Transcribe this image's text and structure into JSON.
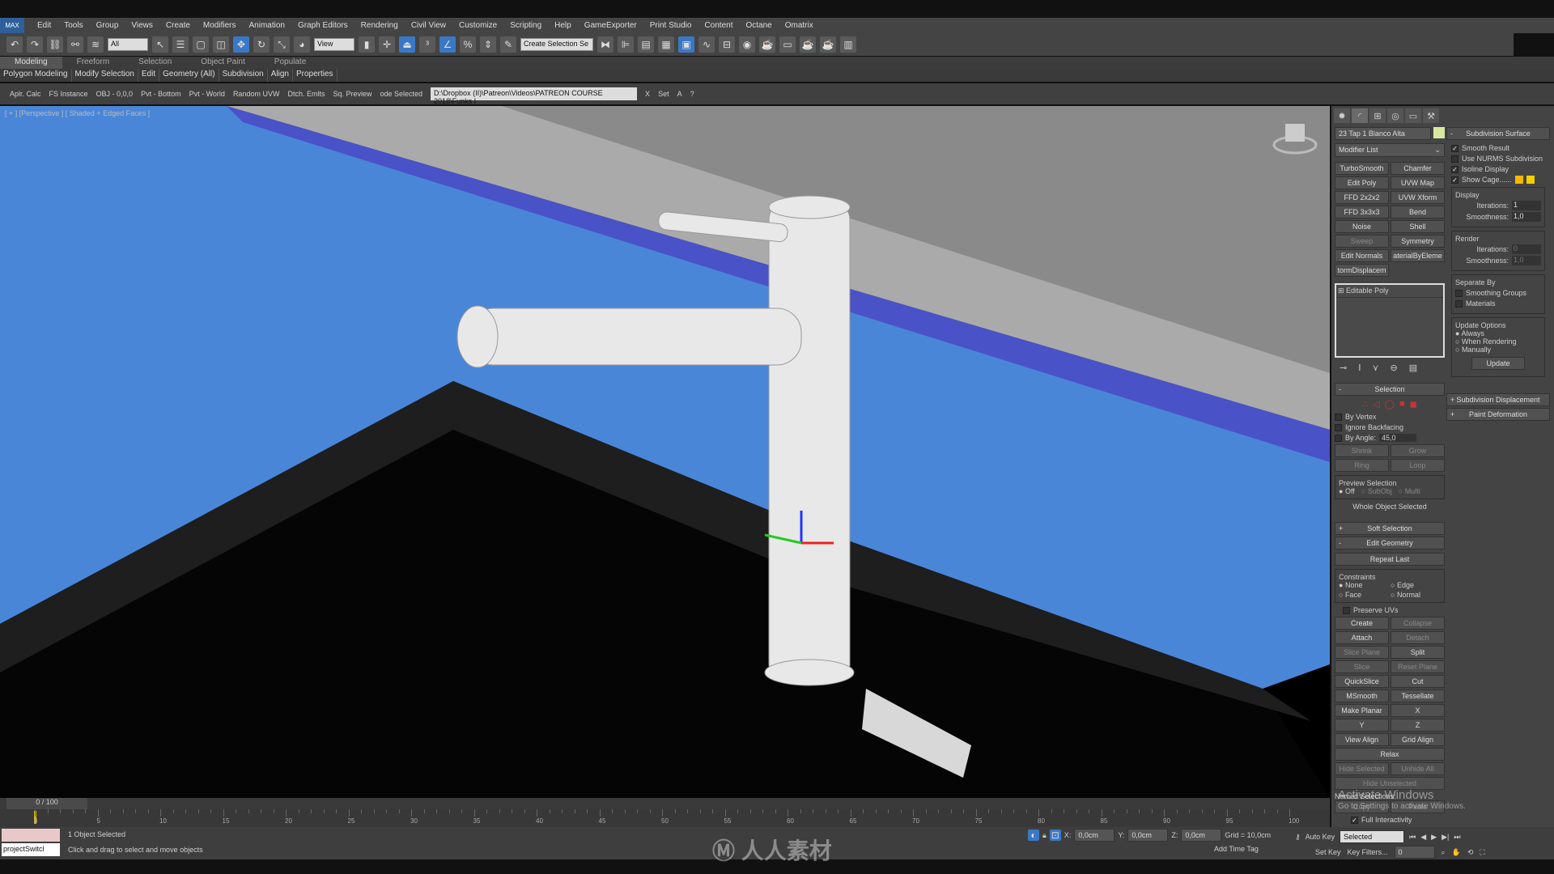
{
  "app": {
    "logo": "MAX"
  },
  "menu": [
    "Edit",
    "Tools",
    "Group",
    "Views",
    "Create",
    "Modifiers",
    "Animation",
    "Graph Editors",
    "Rendering",
    "Civil View",
    "Customize",
    "Scripting",
    "Help",
    "GameExporter",
    "Print Studio",
    "Content",
    "Octane",
    "Omatrix"
  ],
  "toolbar": {
    "filter": "All",
    "ref_coord": "View",
    "named_selection": "Create Selection Se"
  },
  "ribbon": {
    "tabs": [
      "Modeling",
      "Freeform",
      "Selection",
      "Object Paint",
      "Populate"
    ],
    "active": "Modeling",
    "groups": [
      "Polygon Modeling",
      "Modify Selection",
      "Edit",
      "Geometry (All)",
      "Subdivision",
      "Align",
      "Properties"
    ]
  },
  "extra_toolbar": {
    "items": [
      "Aplr. Calc",
      "FS Instance",
      "OBJ - 0,0,0",
      "Pvt - Bottom",
      "Pvt - World",
      "Random UVW",
      "Dtch. Emlts",
      "Sq. Preview",
      "ode Selected"
    ],
    "path": "D:\\Dropbox (II)\\Patreon\\Videos\\PATREON COURSE 2018\\Funks I",
    "x": "X",
    "set": "Set",
    "a": "A",
    "q": "?"
  },
  "viewport": {
    "label": "[ + ] [Perspective ] [ Shaded + Edged Faces ]"
  },
  "command_panel": {
    "object_name": "23 Tap 1 Blanco Alta",
    "object_color": "#d8e8a0",
    "modifier_list": "Modifier List",
    "modifier_buttons": [
      "TurboSmooth",
      "Chamfer",
      "Edit Poly",
      "UVW Map",
      "FFD 2x2x2",
      "UVW Xform",
      "FFD 3x3x3",
      "Bend",
      "Noise",
      "Shell",
      "Sweep",
      "Symmetry",
      "Edit Normals",
      "aterialByEleme",
      "tormDisplacem"
    ],
    "stack_item": "Editable Poly",
    "selection": {
      "title": "Selection",
      "by_vertex": "By Vertex",
      "ignore_backfacing": "Ignore Backfacing",
      "by_angle": "By Angle:",
      "angle": "45,0",
      "shrink": "Shrink",
      "grow": "Grow",
      "ring": "Ring",
      "loop": "Loop",
      "preview": "Preview Selection",
      "off": "Off",
      "subobj": "SubObj",
      "multi": "Multi",
      "status": "Whole Object Selected"
    },
    "soft_selection": "Soft Selection",
    "edit_geometry": {
      "title": "Edit Geometry",
      "repeat_last": "Repeat Last",
      "constraints": "Constraints",
      "none": "None",
      "edge": "Edge",
      "face": "Face",
      "normal": "Normal",
      "preserve_uvs": "Preserve UVs",
      "buttons": [
        "Create",
        "Collapse",
        "Attach",
        "Detach",
        "Slice Plane",
        "Split",
        "Slice",
        "Reset Plane",
        "QuickSlice",
        "Cut",
        "MSmooth",
        "Tessellate",
        "Make Planar",
        "X",
        "Y",
        "Z",
        "View Align",
        "Grid Align",
        "Relax",
        "Hide Selected",
        "Unhide All",
        "Hide Unselected"
      ],
      "named_selections": "Named Selections:",
      "copy": "Copy",
      "paste": "Paste",
      "full_interactivity": "Full Interactivity"
    },
    "subdivision_surface": {
      "title": "Subdivision Surface",
      "smooth_result": "Smooth Result",
      "use_nurms": "Use NURMS Subdivision",
      "isoline": "Isoline Display",
      "show_cage": "Show Cage......",
      "cage_colors": [
        "#f5b800",
        "#f5d000"
      ],
      "display": "Display",
      "iterations": "Iterations:",
      "iter_val": "1",
      "smoothness": "Smoothness:",
      "smooth_val": "1,0",
      "render": "Render",
      "r_iter_val": "0",
      "r_smooth_val": "1,0",
      "separate_by": "Separate By",
      "smoothing_groups": "Smoothing Groups",
      "materials": "Materials",
      "update_options": "Update Options",
      "always": "Always",
      "when_rendering": "When Rendering",
      "manually": "Manually",
      "update": "Update"
    },
    "subdivision_displacement": "Subdivision Displacement",
    "paint_deformation": "Paint Deformation"
  },
  "timeline": {
    "frame": "0 / 100",
    "ticks": [
      "0",
      "5",
      "10",
      "15",
      "20",
      "25",
      "30",
      "35",
      "40",
      "45",
      "50",
      "55",
      "60",
      "65",
      "70",
      "75",
      "80",
      "85",
      "90",
      "95",
      "100"
    ]
  },
  "status": {
    "selected": "1 Object Selected",
    "prompt": "Click and drag to select and move objects",
    "script": "projectSwitcl",
    "x": "0,0cm",
    "y": "0,0cm",
    "z": "0,0cm",
    "grid": "Grid = 10,0cm",
    "add_time_tag": "Add Time Tag",
    "auto_key": "Auto Key",
    "set_key": "Set Key",
    "key_mode": "Selected",
    "key_filters": "Key Filters...",
    "frame": "0"
  },
  "os_notice": {
    "line1": "Activate Windows",
    "line2": "Go to Settings to activate Windows."
  },
  "watermark": "RRCG 人人素材"
}
